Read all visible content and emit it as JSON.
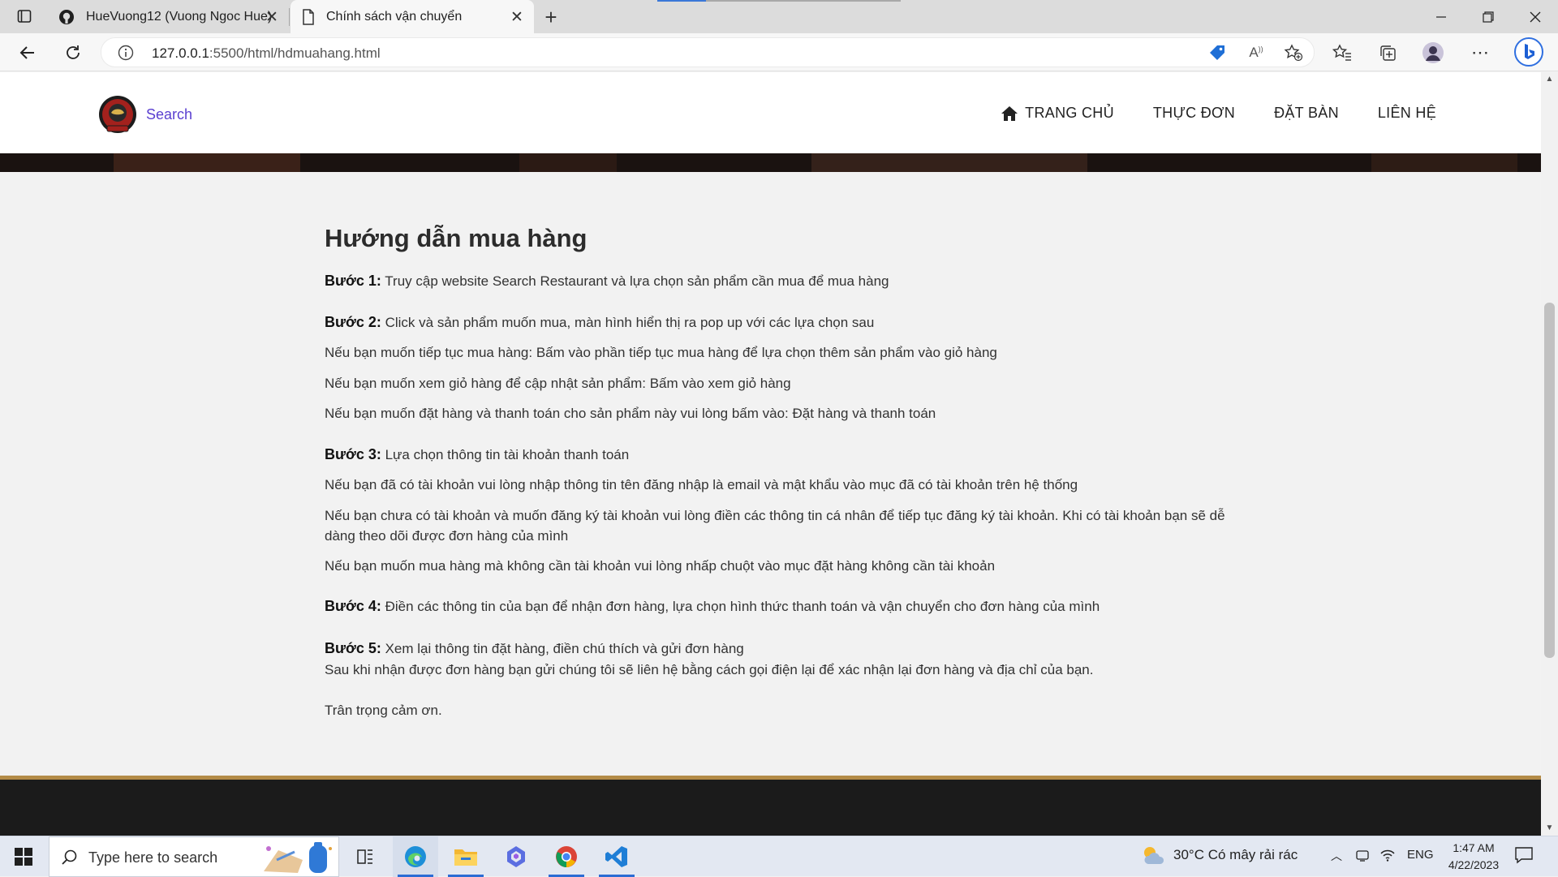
{
  "browser": {
    "tabs": [
      {
        "title": "HueVuong12 (Vuong Ngoc Hue)",
        "icon": "github-icon"
      },
      {
        "title": "Chính sách vận chuyển",
        "icon": "page-icon"
      }
    ],
    "address": {
      "url_host": "127.0.0.1",
      "url_rest": ":5500/html/hdmuahang.html"
    }
  },
  "site": {
    "brand": "Search",
    "menu": [
      "TRANG CHỦ",
      "THỰC ĐƠN",
      "ĐẶT BÀN",
      "LIÊN HỆ"
    ]
  },
  "content": {
    "title": "Hướng dẫn mua hàng",
    "step1": {
      "label": "Bước 1:",
      "text": " Truy cập website Search Restaurant và lựa chọn sản phẩm cần mua để mua hàng"
    },
    "step2": {
      "label": "Bước 2:",
      "text": " Click và sản phẩm muốn mua, màn hình hiển thị ra pop up với các lựa chọn sau"
    },
    "step2_lines": [
      "Nếu bạn muốn tiếp tục mua hàng: Bấm vào phần tiếp tục mua hàng để lựa chọn thêm sản phẩm vào giỏ hàng",
      "Nếu bạn muốn xem giỏ hàng để cập nhật sản phẩm: Bấm vào xem giỏ hàng",
      "Nếu bạn muốn đặt hàng và thanh toán cho sản phẩm này vui lòng bấm vào: Đặt hàng và thanh toán"
    ],
    "step3": {
      "label": "Bước 3:",
      "text": " Lựa chọn thông tin tài khoản thanh toán"
    },
    "step3_lines": [
      "Nếu bạn đã có tài khoản vui lòng nhập thông tin tên đăng nhập là email và mật khẩu vào mục đã có tài khoản trên hệ thống",
      "Nếu bạn chưa có tài khoản và muốn đăng ký tài khoản vui lòng điền các thông tin cá nhân để tiếp tục đăng ký tài khoản. Khi có tài khoản bạn sẽ dễ dàng theo dõi được đơn hàng của mình",
      "Nếu bạn muốn mua hàng mà không cần tài khoản vui lòng nhấp chuột vào mục đặt hàng không cần tài khoản"
    ],
    "step4": {
      "label": "Bước 4:",
      "text": " Điền các thông tin của bạn để nhận đơn hàng, lựa chọn hình thức thanh toán và vận chuyển cho đơn hàng của mình"
    },
    "step5": {
      "label": "Bước 5:",
      "text": " Xem lại thông tin đặt hàng, điền chú thích và gửi đơn hàng"
    },
    "step5_after": "Sau khi nhận được đơn hàng bạn gửi chúng tôi sẽ liên hệ bằng cách gọi điện lại để xác nhận lại đơn hàng và địa chỉ của bạn.",
    "closing": "Trân trọng cảm ơn."
  },
  "taskbar": {
    "search_placeholder": "Type here to search",
    "weather": "30°C  Có mây rải rác",
    "lang": "ENG",
    "time": "1:47 AM",
    "date": "4/22/2023"
  },
  "colors": {
    "accent": "#b38b47",
    "brand_text": "#5a3fd0",
    "footer": "#1b1b1b",
    "taskbar": "#e3e8f2"
  }
}
